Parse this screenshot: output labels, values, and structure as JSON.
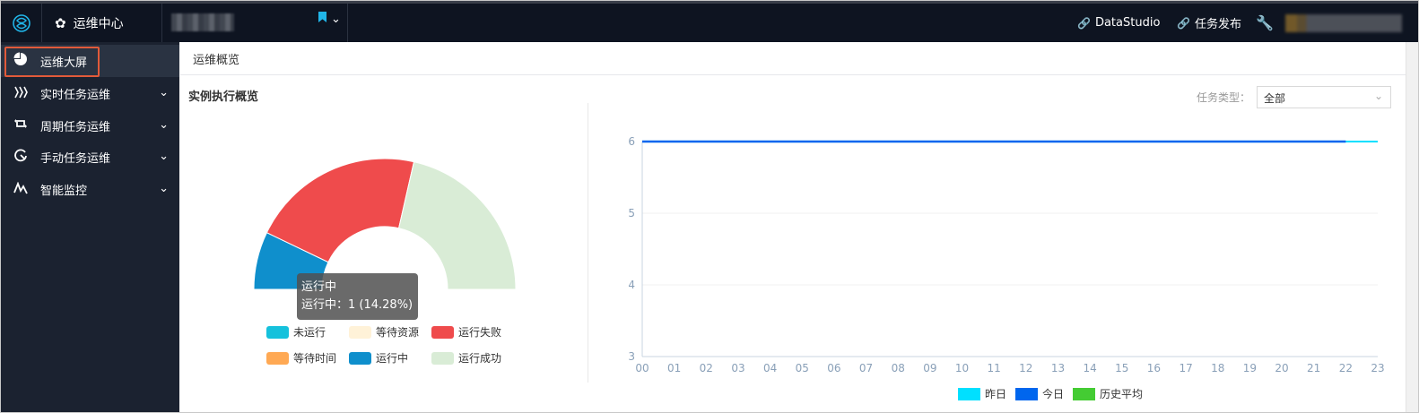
{
  "topbar": {
    "app_title": "运维中心",
    "links": [
      {
        "label": "DataStudio"
      },
      {
        "label": "任务发布"
      }
    ]
  },
  "sidebar": {
    "items": [
      {
        "label": "运维大屏",
        "icon": "pie-chart-icon"
      },
      {
        "label": "实时任务运维",
        "icon": "stream-icon"
      },
      {
        "label": "周期任务运维",
        "icon": "cycle-icon"
      },
      {
        "label": "手动任务运维",
        "icon": "manual-icon"
      },
      {
        "label": "智能监控",
        "icon": "pulse-icon"
      }
    ]
  },
  "breadcrumb": "运维概览",
  "panel": {
    "title": "实例执行概览",
    "filter_label": "任务类型：",
    "filter_value": "全部"
  },
  "colors": {
    "topbar_bg": "#0e1421",
    "sidebar_bg": "#1b2230",
    "accent": "#20b5e8",
    "highlight_border": "#e25a3a"
  },
  "status_legend": [
    {
      "label": "未运行",
      "color": "#15c1dc"
    },
    {
      "label": "等待资源",
      "color": "#fff2d8"
    },
    {
      "label": "运行失败",
      "color": "#ef4b4c"
    },
    {
      "label": "等待时间",
      "color": "#ffa954"
    },
    {
      "label": "运行中",
      "color": "#0f8fcc"
    },
    {
      "label": "运行成功",
      "color": "#d9ecd6"
    }
  ],
  "tooltip": {
    "title": "运行中",
    "text": "运行中：1 (14.28%)"
  },
  "chart_data": [
    {
      "type": "pie",
      "shape": "half-donut",
      "slices": [
        {
          "name": "运行中",
          "value": 1,
          "percent": 14.28,
          "color": "#0f8fcc"
        },
        {
          "name": "运行失败",
          "value": 3,
          "color": "#ef4b4c"
        },
        {
          "name": "运行成功",
          "value": 3,
          "color": "#d9ecd6"
        }
      ]
    },
    {
      "type": "line",
      "categories": [
        "00",
        "01",
        "02",
        "03",
        "04",
        "05",
        "06",
        "07",
        "08",
        "09",
        "10",
        "11",
        "12",
        "13",
        "14",
        "15",
        "16",
        "17",
        "18",
        "19",
        "20",
        "21",
        "22",
        "23"
      ],
      "ylim": [
        3,
        6
      ],
      "yticks": [
        3,
        4,
        5,
        6
      ],
      "series": [
        {
          "name": "昨日",
          "color": "#00e0ff",
          "values": [
            6,
            6,
            6,
            6,
            6,
            6,
            6,
            6,
            6,
            6,
            6,
            6,
            6,
            6,
            6,
            6,
            6,
            6,
            6,
            6,
            6,
            6,
            6,
            6
          ]
        },
        {
          "name": "今日",
          "color": "#0066ee",
          "values": [
            6,
            6,
            6,
            6,
            6,
            6,
            6,
            6,
            6,
            6,
            6,
            6,
            6,
            6,
            6,
            6,
            6,
            6,
            6,
            6,
            6,
            6,
            6
          ]
        },
        {
          "name": "历史平均",
          "color": "#44cc33",
          "values": []
        }
      ],
      "legend": "bottom-center"
    }
  ]
}
